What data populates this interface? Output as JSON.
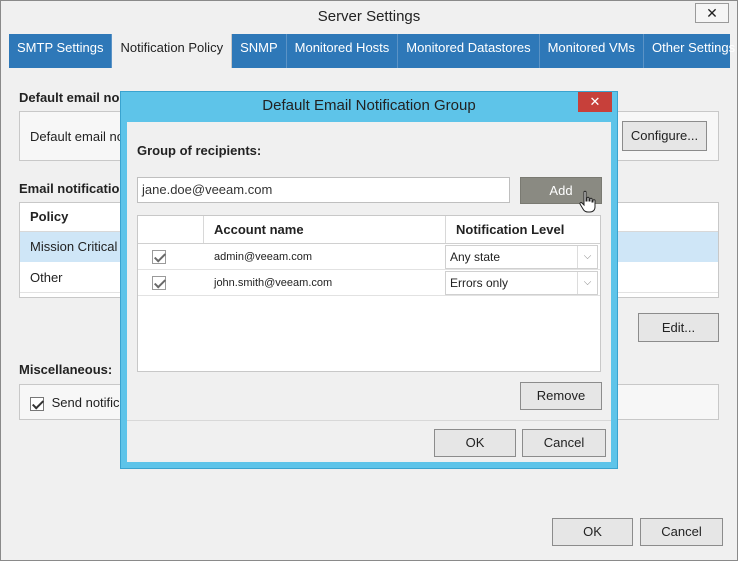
{
  "window": {
    "title": "Server Settings",
    "close_glyph": "✕"
  },
  "tabs": [
    {
      "label": "SMTP Settings",
      "active": false
    },
    {
      "label": "Notification Policy",
      "active": true
    },
    {
      "label": "SNMP",
      "active": false
    },
    {
      "label": "Monitored Hosts",
      "active": false
    },
    {
      "label": "Monitored Datastores",
      "active": false
    },
    {
      "label": "Monitored VMs",
      "active": false
    },
    {
      "label": "Other Settings",
      "active": false
    }
  ],
  "panel": {
    "default_email_label": "Default email no",
    "default_email_text": "Default email no",
    "configure_button": "Configure...",
    "email_notification_label": "Email notification",
    "policy_header": "Policy",
    "policy_rows": [
      "Mission Critical",
      "Other"
    ],
    "edit_button": "Edit...",
    "misc_label": "Miscellaneous:",
    "send_checkbox_label": "Send notifica"
  },
  "footer": {
    "ok_label": "OK",
    "cancel_label": "Cancel"
  },
  "dialog": {
    "title": "Default Email Notification Group",
    "close_glyph": "✕",
    "group_label": "Group of recipients:",
    "email_input_value": "jane.doe@veeam.com",
    "add_button": "Add",
    "columns": {
      "account": "Account name",
      "level": "Notification Level"
    },
    "rows": [
      {
        "account": "admin@veeam.com",
        "level": "Any state",
        "checked": true
      },
      {
        "account": "john.smith@veeam.com",
        "level": "Errors only",
        "checked": true
      }
    ],
    "remove_button": "Remove",
    "ok_label": "OK",
    "cancel_label": "Cancel"
  },
  "icons": {
    "cursor": "hand-pointer-icon",
    "dropdown": "chevron-down-icon",
    "check": "checkmark-icon"
  }
}
